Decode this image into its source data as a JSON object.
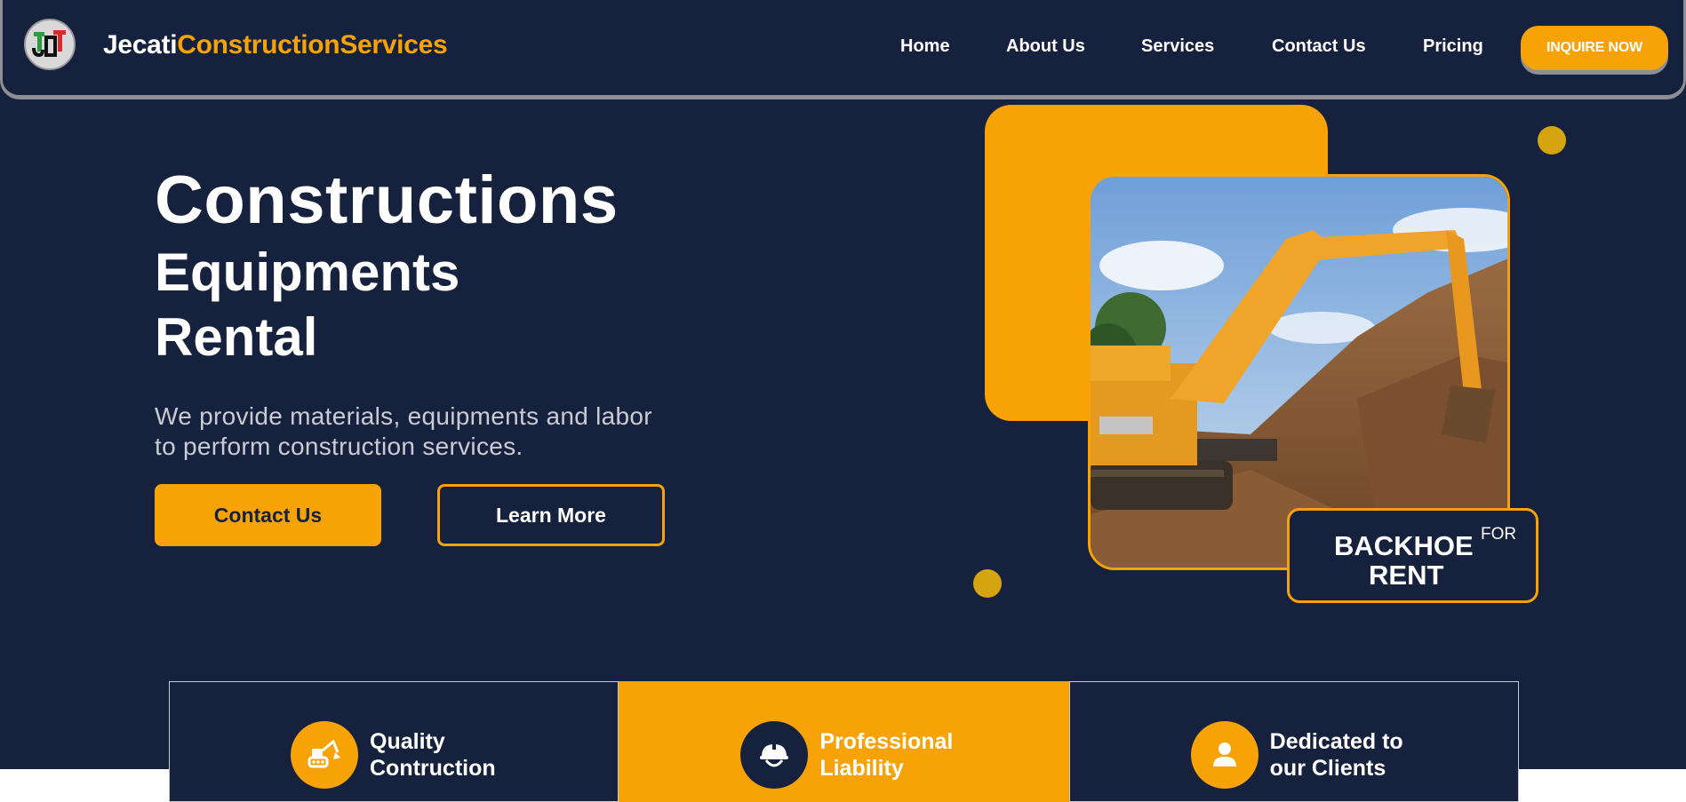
{
  "nav": {
    "brand_part1": "Jecati",
    "brand_part2": "ConstructionServices",
    "logo_text": "JCT",
    "links": [
      "Home",
      "About Us",
      "Services",
      "Contact Us",
      "Pricing"
    ],
    "cta": "INQUIRE NOW"
  },
  "hero": {
    "title": "Constructions",
    "subtitle_line1": "Equipments",
    "subtitle_line2": "Rental",
    "description": "We provide materials, equipments and labor to perform construction services.",
    "primary_button": "Contact Us",
    "secondary_button": "Learn More"
  },
  "promo": {
    "line1": "BACKHOE",
    "for": "FOR",
    "line2": "RENT",
    "image_alt": "Orange excavator digging a trench"
  },
  "features": [
    {
      "title_line1": "Quality",
      "title_line2": "Contruction",
      "icon": "excavator-icon"
    },
    {
      "title_line1": "Professional",
      "title_line2": "Liability",
      "icon": "hard-hat-icon"
    },
    {
      "title_line1": "Dedicated to",
      "title_line2": "our Clients",
      "icon": "user-icon"
    }
  ],
  "colors": {
    "navy": "#15213d",
    "accent": "#f7a308",
    "dot": "#d4a510"
  }
}
